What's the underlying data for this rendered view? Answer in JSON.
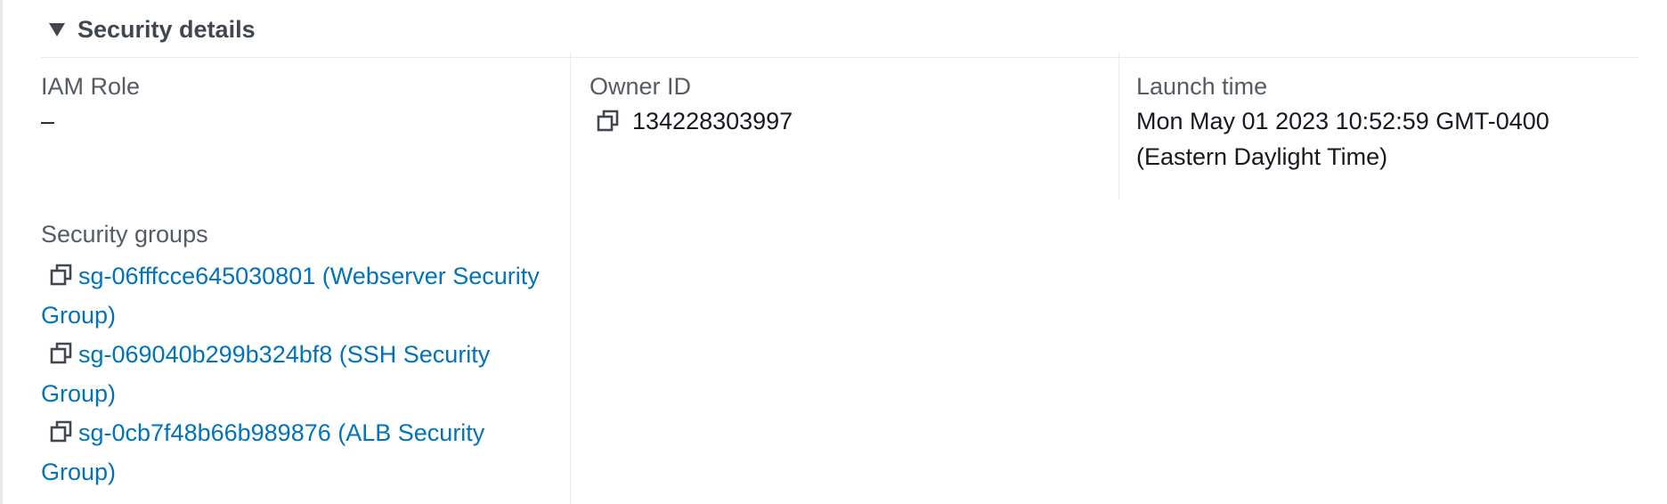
{
  "panel": {
    "title": "Security details"
  },
  "fields": {
    "iam_role": {
      "label": "IAM Role",
      "value": "–"
    },
    "owner_id": {
      "label": "Owner ID",
      "value": "134228303997"
    },
    "launch_time": {
      "label": "Launch time",
      "value_line1": "Mon May 01 2023 10:52:59 GMT-0400",
      "value_line2": "(Eastern Daylight Time)"
    },
    "security_groups": {
      "label": "Security groups",
      "items": [
        {
          "text": "sg-06fffcce645030801 (Webserver Security Group)"
        },
        {
          "text": "sg-069040b299b324bf8 (SSH Security Group)"
        },
        {
          "text": "sg-0cb7f48b66b989876 (ALB Security Group)"
        }
      ]
    }
  },
  "icons": {
    "copy": "copy-icon",
    "caret": "caret-down-icon"
  },
  "colors": {
    "link": "#0073bb",
    "label": "#545b64",
    "heading": "#414750",
    "text": "#16191f",
    "divider": "#e9ebed"
  }
}
